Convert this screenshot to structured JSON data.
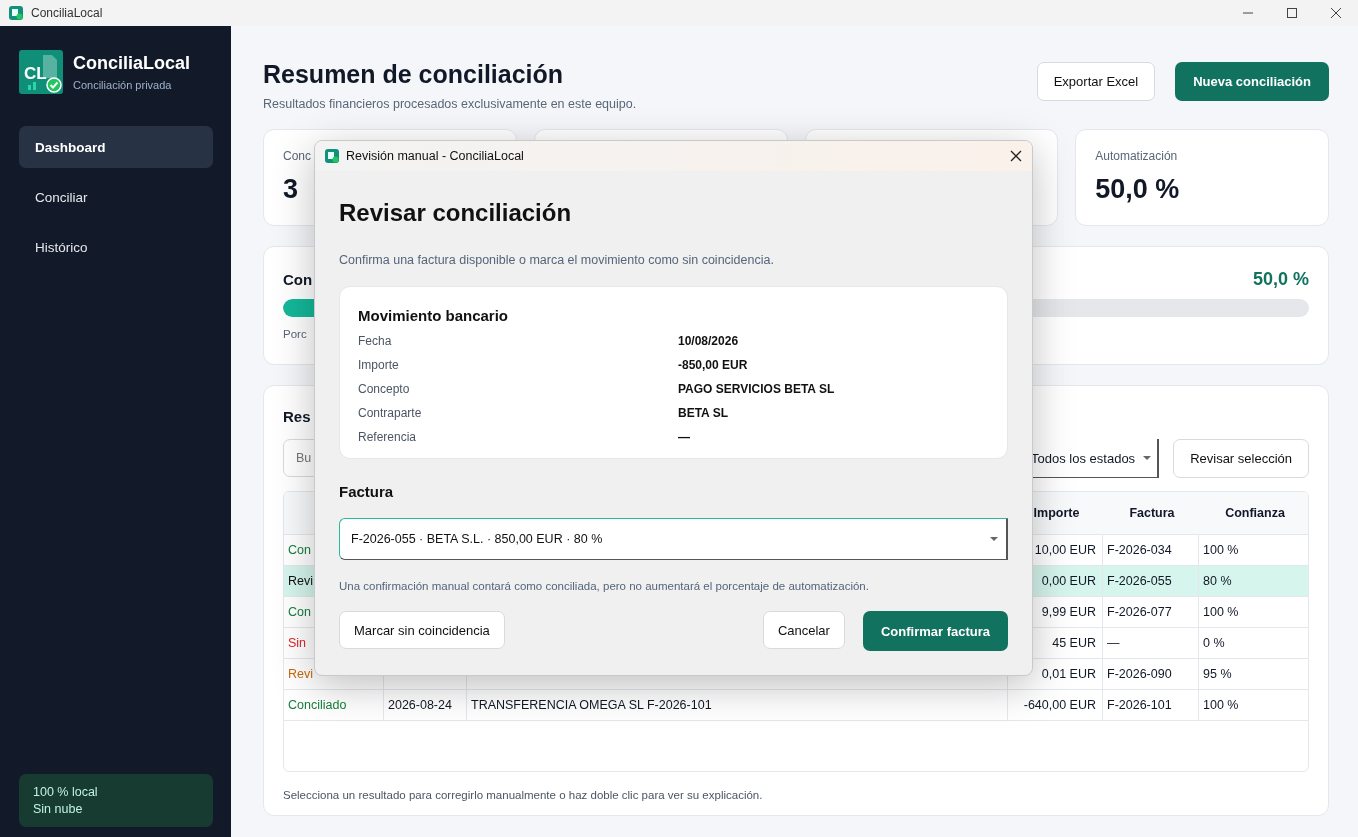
{
  "window": {
    "title": "ConciliaLocal"
  },
  "sidebar": {
    "brand": "ConciliaLocal",
    "tagline": "Conciliación privada",
    "logo_mark": "CL",
    "items": [
      {
        "label": "Dashboard",
        "selected": true
      },
      {
        "label": "Conciliar",
        "selected": false
      },
      {
        "label": "Histórico",
        "selected": false
      }
    ],
    "footer": [
      "100 % local",
      "Sin nube"
    ]
  },
  "header": {
    "title": "Resumen de conciliación",
    "subtitle": "Resultados financieros procesados exclusivamente en este equipo.",
    "buttons": [
      {
        "label": "Exportar Excel",
        "kind": "secondary"
      },
      {
        "label": "Nueva conciliación",
        "kind": "primary"
      }
    ]
  },
  "stats": [
    {
      "label": "Conc",
      "value": "3"
    },
    {
      "label": "Automatización",
      "value": "50,0 %"
    }
  ],
  "progress": {
    "title": "Con",
    "value": "50,0 %",
    "level": 0.5,
    "caption": "Porc"
  },
  "results": {
    "title": "Res",
    "search": {
      "placeholder": "Bu"
    },
    "filter": "Todos los estados",
    "review_button": "Revisar selección",
    "table": {
      "columns": [
        "Importe",
        "Factura",
        "Confianza"
      ],
      "rows": [
        {
          "status": "Con",
          "kind": "ok",
          "amount": "10,00 EUR",
          "invoice": "F-2026-034",
          "confidence": "100 %",
          "selected": false
        },
        {
          "status": "Revi",
          "kind": "review",
          "amount": "0,00 EUR",
          "invoice": "F-2026-055",
          "confidence": "80 %",
          "selected": true
        },
        {
          "status": "Con",
          "kind": "ok",
          "amount": "9,99 EUR",
          "invoice": "F-2026-077",
          "confidence": "100 %",
          "selected": false
        },
        {
          "status": "Sin",
          "kind": "none",
          "amount": "45 EUR",
          "invoice": "—",
          "confidence": "0 %",
          "selected": false
        },
        {
          "status": "Revi",
          "kind": "review",
          "amount": "0,01 EUR",
          "invoice": "F-2026-090",
          "confidence": "95 %",
          "selected": false
        },
        {
          "status": "Conciliado",
          "kind": "ok",
          "date": "2026-08-24",
          "concept": "TRANSFERENCIA OMEGA SL F-2026-101",
          "amount": "-640,00 EUR",
          "invoice": "F-2026-101",
          "confidence": "100 %",
          "selected": false
        }
      ]
    },
    "footer": "Selecciona un resultado para corregirlo manualmente o haz doble clic para ver su explicación."
  },
  "dialog": {
    "title": "Revisión manual - ConciliaLocal",
    "heading": "Revisar conciliación",
    "intro": "Confirma una factura disponible o marca el movimiento como sin coincidencia.",
    "movement": {
      "title": "Movimiento bancario",
      "fields": [
        {
          "label": "Fecha",
          "value": "10/08/2026"
        },
        {
          "label": "Importe",
          "value": "-850,00 EUR"
        },
        {
          "label": "Concepto",
          "value": "PAGO SERVICIOS BETA SL"
        },
        {
          "label": "Contraparte",
          "value": "BETA SL"
        },
        {
          "label": "Referencia",
          "value": "—"
        }
      ]
    },
    "invoice_label": "Factura",
    "invoice_value": "F-2026-055 · BETA S.L. · 850,00 EUR · 80 %",
    "note": "Una confirmación manual contará como conciliada, pero no aumentará el porcentaje de automatización.",
    "buttons": [
      {
        "label": "Marcar sin coincidencia",
        "kind": "secondary"
      },
      {
        "label": "Cancelar",
        "kind": "secondary"
      },
      {
        "label": "Confirmar factura",
        "kind": "primary"
      }
    ]
  }
}
